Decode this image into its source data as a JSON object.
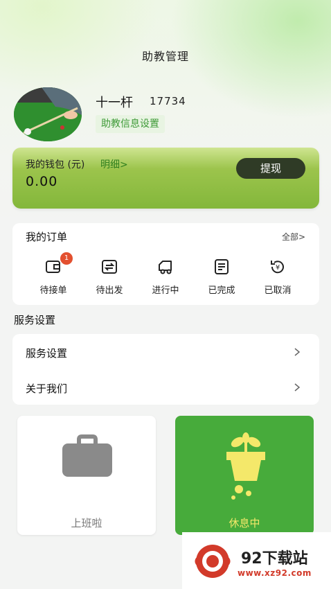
{
  "header": {
    "title": "助教管理"
  },
  "profile": {
    "name": "十一杆",
    "id": "17734",
    "settings_label": "助教信息设置"
  },
  "wallet": {
    "title": "我的钱包 (元)",
    "detail_link": "明细>",
    "balance": "0.00",
    "withdraw_label": "提现"
  },
  "orders": {
    "title": "我的订单",
    "all_link": "全部>",
    "items": [
      {
        "label": "待接单",
        "icon": "wallet-icon",
        "badge": "1"
      },
      {
        "label": "待出发",
        "icon": "depart-icon"
      },
      {
        "label": "进行中",
        "icon": "truck-icon"
      },
      {
        "label": "已完成",
        "icon": "document-icon"
      },
      {
        "label": "已取消",
        "icon": "refund-icon"
      }
    ]
  },
  "services": {
    "section_title": "服务设置",
    "rows": [
      {
        "label": "服务设置"
      },
      {
        "label": "关于我们"
      }
    ]
  },
  "status": {
    "work": {
      "label": "上班啦",
      "icon": "briefcase-icon",
      "color": "#8a8a8a"
    },
    "rest": {
      "label": "休息中",
      "icon": "potted-plant-icon",
      "color": "#47ab3b"
    }
  },
  "watermark": {
    "title": "92下载站",
    "url": "www.xz92.com"
  },
  "colors": {
    "accent": "#47ab3b",
    "badge": "#e3502f",
    "button_dark": "#2f3b26"
  }
}
